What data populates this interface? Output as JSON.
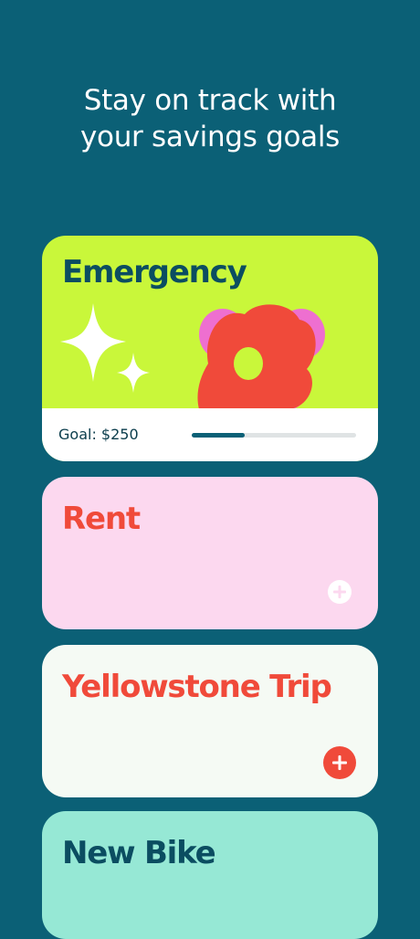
{
  "headline": {
    "line1": "Stay on track with",
    "line2": "your savings goals"
  },
  "cards": [
    {
      "title": "Emergency",
      "goal_label": "Goal: $250",
      "progress": 0.32,
      "background": "#c9f73a",
      "title_color": "#0b4d61",
      "art": [
        "sparkle-icon",
        "sparkle-small-icon",
        "flower-icon"
      ]
    },
    {
      "title": "Rent",
      "background": "#fcd8ef",
      "title_color": "#f04a3a",
      "add_icon": "plus-circle-icon"
    },
    {
      "title": "Yellowstone Trip",
      "background": "#f5faf4",
      "title_color": "#f04a3a",
      "add_icon": "plus-circle-icon"
    },
    {
      "title": "New Bike",
      "background": "#96e8d5",
      "title_color": "#0b4d61"
    }
  ],
  "colors": {
    "page_background": "#0b6076",
    "accent_red": "#f04a3a",
    "accent_pink": "#ee6fd0",
    "progress_fill": "#0b6076"
  }
}
